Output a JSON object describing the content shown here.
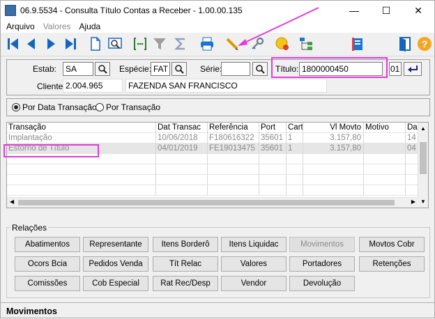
{
  "window": {
    "title": "06.9.5534 - Consulta Título Contas a Receber - 1.00.00.135",
    "minimize": "—",
    "maximize": "☐",
    "close": "✕"
  },
  "menu": {
    "arquivo": "Arquivo",
    "valores": "Valores",
    "ajuda": "Ajuda"
  },
  "toolbar": {
    "icons": [
      "first-icon",
      "prev-icon",
      "next-icon",
      "last-icon",
      "new-doc-icon",
      "zoom-icon",
      "goto-icon",
      "filter-icon",
      "sum-icon",
      "print-icon",
      "pencil-icon",
      "key-icon",
      "coin-icon",
      "tree-icon",
      "book-icon",
      "exit-door-icon",
      "help-icon"
    ],
    "help_label": "?"
  },
  "form": {
    "estab_label": "Estab:",
    "estab_value": "SA",
    "especie_label": "Espécie:",
    "especie_value": "FAT",
    "serie_label": "Série:",
    "serie_value": "",
    "titulo_label": "Título:",
    "titulo_value": "1800000450",
    "parcela_value": "01",
    "cliente_label": "Cliente:",
    "cliente_code": "2.004.965",
    "cliente_name": "FAZENDA SAN FRANCISCO"
  },
  "options": {
    "por_data": "Por Data Transação",
    "por_transacao": "Por Transação"
  },
  "grid": {
    "columns": [
      "Transação",
      "Dat Transac",
      "Referência",
      "Port",
      "Cart",
      "Vl Movto",
      "Motivo",
      "Da"
    ],
    "rows": [
      [
        "Implantação",
        "10/06/2018",
        "F180616322",
        "35601",
        "1",
        "3.157,80",
        "",
        "14"
      ],
      [
        "Estorno de Título",
        "04/01/2019",
        "FE19013475",
        "35601",
        "1",
        "3.157,80",
        "",
        "04"
      ]
    ]
  },
  "relacoes": {
    "title": "Relações",
    "buttons": [
      [
        "Abatimentos",
        "Representante",
        "Itens Borderô",
        "Itens Liquidac",
        "Movimentos",
        "Movtos Cobr"
      ],
      [
        "Ocors Bcia",
        "Pedidos Venda",
        "Tít  Relac",
        "Valores",
        "Portadores",
        "Retenções"
      ],
      [
        "Comissões",
        "Cob Especial",
        "Rat Rec/Desp",
        "Vendor",
        "Devolução",
        ""
      ]
    ]
  },
  "status": {
    "text": "Movimentos"
  },
  "colors": {
    "highlight": "#e23ad8",
    "nav_blue": "#1565c0"
  }
}
